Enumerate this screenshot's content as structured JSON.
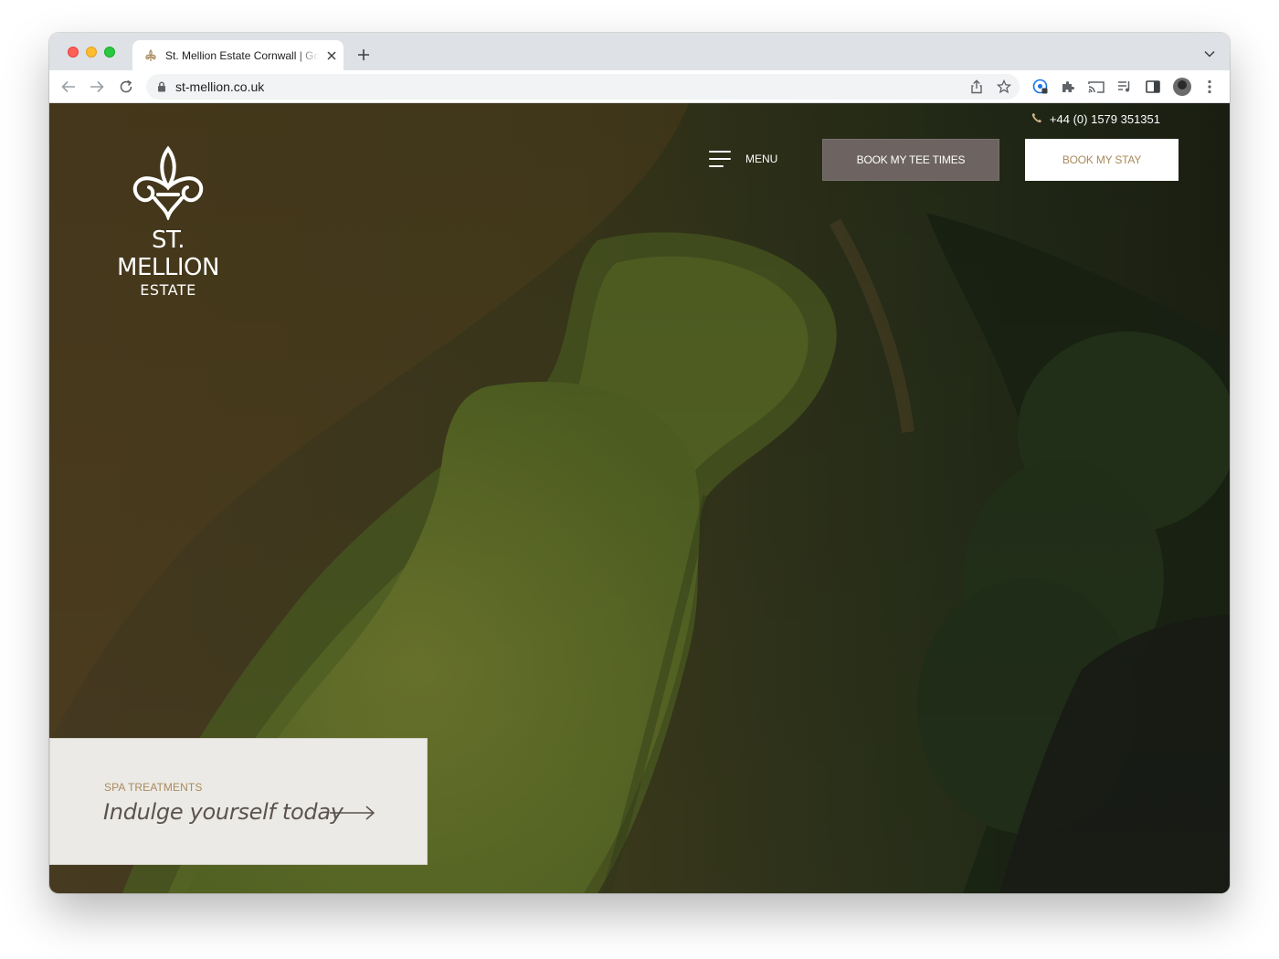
{
  "browser": {
    "tab": {
      "title": "St. Mellion Estate Cornwall | Golf, Spa & Hotel"
    },
    "address_bar": {
      "url": "st-mellion.co.uk"
    }
  },
  "site": {
    "phone": "+44 (0) 1579 351351",
    "logo": {
      "wordmark": "ST. MELLION",
      "subtitle": "ESTATE"
    },
    "nav": {
      "menu_label": "MENU",
      "book_tee_times_label": "BOOK MY TEE TIMES",
      "book_stay_label": "BOOK MY STAY"
    },
    "promo": {
      "kicker": "SPA TREATMENTS",
      "headline": "Indulge yourself today"
    }
  },
  "colors": {
    "tee_button_bg": "#6d6461",
    "stay_button_text": "#a88a5c",
    "promo_kicker": "#a88a5c",
    "promo_bg": "#eceae6"
  },
  "icons": [
    "fleur-de-lis-icon",
    "phone-icon",
    "hamburger-icon",
    "arrow-right-icon"
  ]
}
